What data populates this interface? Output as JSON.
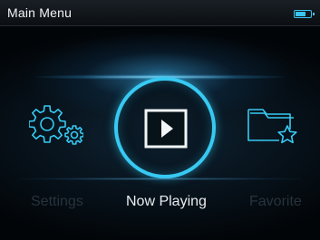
{
  "header": {
    "title": "Main Menu",
    "battery_icon": "battery-icon"
  },
  "menu": {
    "items": [
      {
        "label": "Settings",
        "icon": "gear-icon",
        "selected": false
      },
      {
        "label": "Now Playing",
        "icon": "play-icon",
        "selected": true
      },
      {
        "label": "Favorite",
        "icon": "folder-star-icon",
        "selected": false
      }
    ]
  },
  "colors": {
    "accent": "#37c9f2",
    "background": "#07121b",
    "inactive_label": "#27333b",
    "active_label": "#e9edf0"
  }
}
